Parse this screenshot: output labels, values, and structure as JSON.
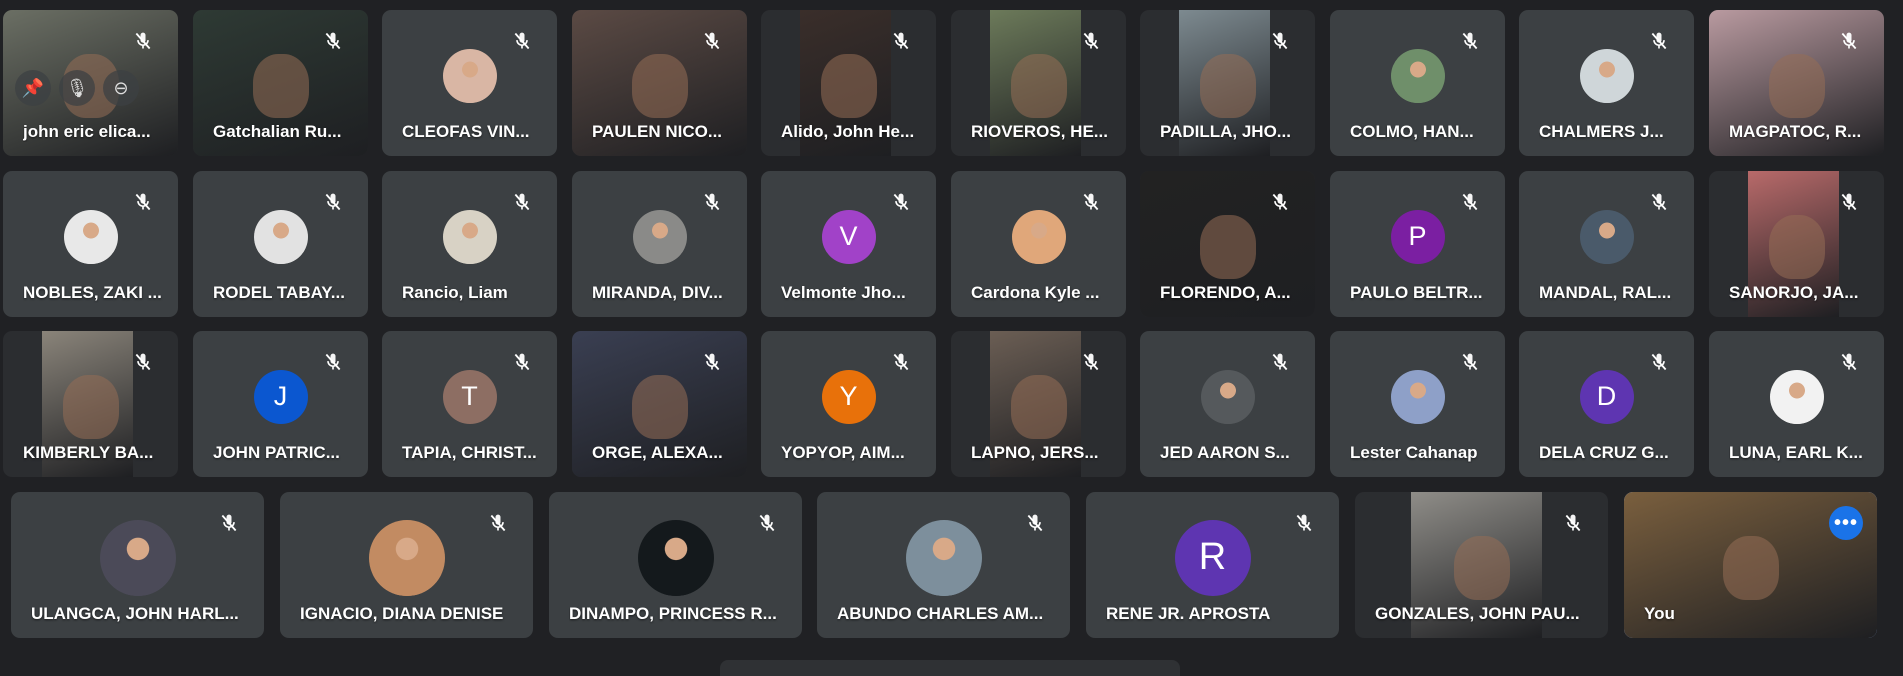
{
  "participants": [
    {
      "row": 0,
      "name": "john eric elica...",
      "kind": "video",
      "color": "#6b6f64"
    },
    {
      "row": 0,
      "name": "Gatchalian Ru...",
      "kind": "video",
      "color": "#2e3a34"
    },
    {
      "row": 0,
      "name": "CLEOFAS VIN...",
      "kind": "photo",
      "color": "#d9b6a4"
    },
    {
      "row": 0,
      "name": "PAULEN NICO...",
      "kind": "video",
      "color": "#5b4a44"
    },
    {
      "row": 0,
      "name": "Alido, John He...",
      "kind": "video",
      "color": "#3a2e2a"
    },
    {
      "row": 0,
      "name": "RIOVEROS, HE...",
      "kind": "video",
      "color": "#6c7a5a"
    },
    {
      "row": 0,
      "name": "PADILLA, JHO...",
      "kind": "video",
      "color": "#7d8a90"
    },
    {
      "row": 0,
      "name": "COLMO, HAN...",
      "kind": "photo",
      "color": "#6f8f6a"
    },
    {
      "row": 0,
      "name": "CHALMERS J...",
      "kind": "photo",
      "color": "#cfd6d9"
    },
    {
      "row": 0,
      "name": "MAGPATOC, R...",
      "kind": "video",
      "color": "#b99aa0"
    },
    {
      "row": 1,
      "name": "NOBLES, ZAKI ...",
      "kind": "photo",
      "color": "#e8e8e8"
    },
    {
      "row": 1,
      "name": "RODEL TABAY...",
      "kind": "photo",
      "color": "#e2e2e2"
    },
    {
      "row": 1,
      "name": "Rancio, Liam",
      "kind": "photo",
      "color": "#d8d2c5"
    },
    {
      "row": 1,
      "name": "MIRANDA, DIV...",
      "kind": "photo",
      "color": "#8a8a88"
    },
    {
      "row": 1,
      "name": "Velmonte Jho...",
      "kind": "letter",
      "letter": "V",
      "color": "#a142c8"
    },
    {
      "row": 1,
      "name": "Cardona Kyle ...",
      "kind": "photo",
      "color": "#e0a77a"
    },
    {
      "row": 1,
      "name": "FLORENDO, A...",
      "kind": "video",
      "color": "#222"
    },
    {
      "row": 1,
      "name": "PAULO BELTR...",
      "kind": "letter",
      "letter": "P",
      "color": "#7b1fa2"
    },
    {
      "row": 1,
      "name": "MANDAL, RAL...",
      "kind": "photo",
      "color": "#4a5a6a"
    },
    {
      "row": 1,
      "name": "SANORJO, JA...",
      "kind": "video",
      "color": "#b86a6a"
    },
    {
      "row": 2,
      "name": "KIMBERLY BA...",
      "kind": "video",
      "color": "#8a847a"
    },
    {
      "row": 2,
      "name": "JOHN PATRIC...",
      "kind": "letter",
      "letter": "J",
      "color": "#0b57d0"
    },
    {
      "row": 2,
      "name": "TAPIA, CHRIST...",
      "kind": "letter",
      "letter": "T",
      "color": "#8d6e63"
    },
    {
      "row": 2,
      "name": "ORGE, ALEXA...",
      "kind": "video",
      "color": "#3a3f52"
    },
    {
      "row": 2,
      "name": "YOPYOP, AIM...",
      "kind": "letter",
      "letter": "Y",
      "color": "#e8710a"
    },
    {
      "row": 2,
      "name": "LAPNO, JERS...",
      "kind": "video",
      "color": "#6b5e54"
    },
    {
      "row": 2,
      "name": "JED AARON S...",
      "kind": "photo",
      "color": "#55595c"
    },
    {
      "row": 2,
      "name": "Lester Cahanap",
      "kind": "photo",
      "color": "#8ea0c8"
    },
    {
      "row": 2,
      "name": "DELA CRUZ G...",
      "kind": "letter",
      "letter": "D",
      "color": "#5e35b1"
    },
    {
      "row": 2,
      "name": "LUNA, EARL K...",
      "kind": "photo",
      "color": "#f2f2f2"
    },
    {
      "row": 3,
      "name": "ULANGCA, JOHN HARL...",
      "kind": "photo",
      "color": "#4b4a58"
    },
    {
      "row": 3,
      "name": "IGNACIO, DIANA DENISE",
      "kind": "photo",
      "color": "#c28b62"
    },
    {
      "row": 3,
      "name": "DINAMPO, PRINCESS R...",
      "kind": "photo",
      "color": "#14191c"
    },
    {
      "row": 3,
      "name": "ABUNDO CHARLES AM...",
      "kind": "photo",
      "color": "#7d8f9c"
    },
    {
      "row": 3,
      "name": "RENE JR. APROSTA",
      "kind": "letter",
      "letter": "R",
      "color": "#5e35b1"
    },
    {
      "row": 3,
      "name": "GONZALES, JOHN PAU...",
      "kind": "video",
      "color": "#8f8d88"
    },
    {
      "row": 3,
      "name": "You",
      "kind": "self",
      "color": "#7a5f3e"
    }
  ],
  "icons": {
    "mic_off": "mic-off-icon",
    "pin": "pin-icon",
    "mute_participant": "mute-participant-icon",
    "remove": "remove-icon",
    "more": "more-options-icon"
  },
  "self_more_label": "•••",
  "accent": "#8ab4f8"
}
